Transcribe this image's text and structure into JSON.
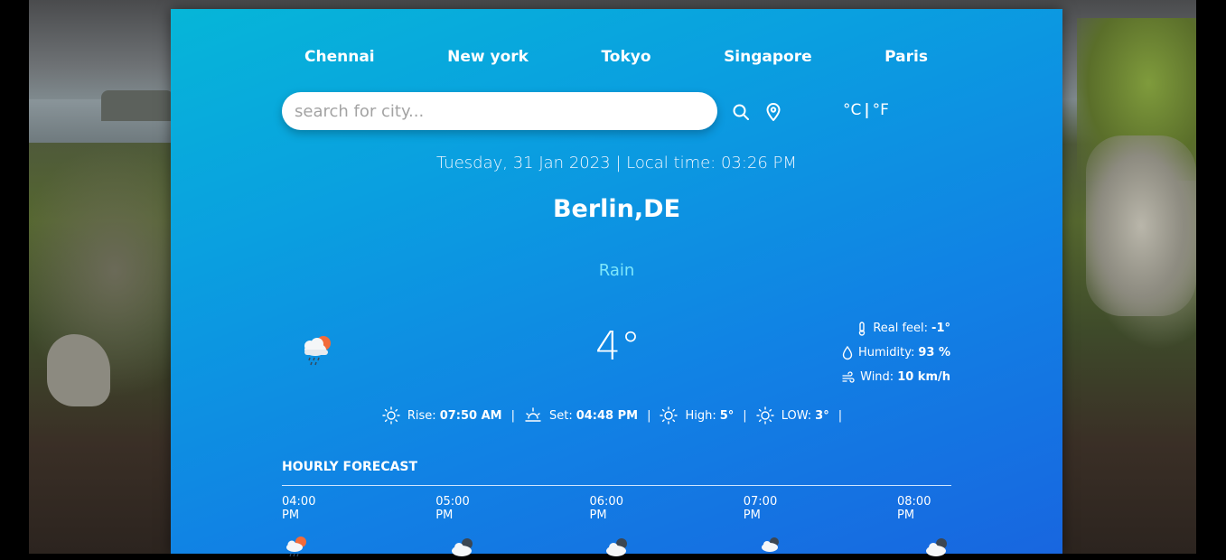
{
  "cities": [
    "Chennai",
    "New york",
    "Tokyo",
    "Singapore",
    "Paris"
  ],
  "search": {
    "placeholder": "search for city..."
  },
  "units": {
    "celsius": "°C",
    "separator": "|",
    "fahrenheit": "°F"
  },
  "datetime": "Tuesday, 31 Jan 2023 | Local time: 03:26 PM",
  "location": "Berlin,DE",
  "condition": "Rain",
  "temperature": "4°",
  "details": {
    "real_feel_label": "Real feel:",
    "real_feel_value": "-1°",
    "humidity_label": "Humidity:",
    "humidity_value": "93 %",
    "wind_label": "Wind:",
    "wind_value": "10 km/h"
  },
  "sun": {
    "rise_label": "Rise:",
    "rise_value": "07:50 AM",
    "set_label": "Set:",
    "set_value": "04:48 PM",
    "high_label": "High:",
    "high_value": "5°",
    "low_label": "LOW:",
    "low_value": "3°",
    "separator": "|"
  },
  "hourly": {
    "title": "HOURLY FORECAST",
    "items": [
      {
        "time": "04:00 PM",
        "icon": "rain-sun-icon"
      },
      {
        "time": "05:00 PM",
        "icon": "cloud-icon"
      },
      {
        "time": "06:00 PM",
        "icon": "cloud-icon"
      },
      {
        "time": "07:00 PM",
        "icon": "cloud-icon"
      },
      {
        "time": "08:00 PM",
        "icon": "cloud-icon"
      }
    ]
  },
  "colors": {
    "accent": "#7ee7fb",
    "panel_top": "#06b6d8",
    "panel_bottom": "#1866e0"
  }
}
